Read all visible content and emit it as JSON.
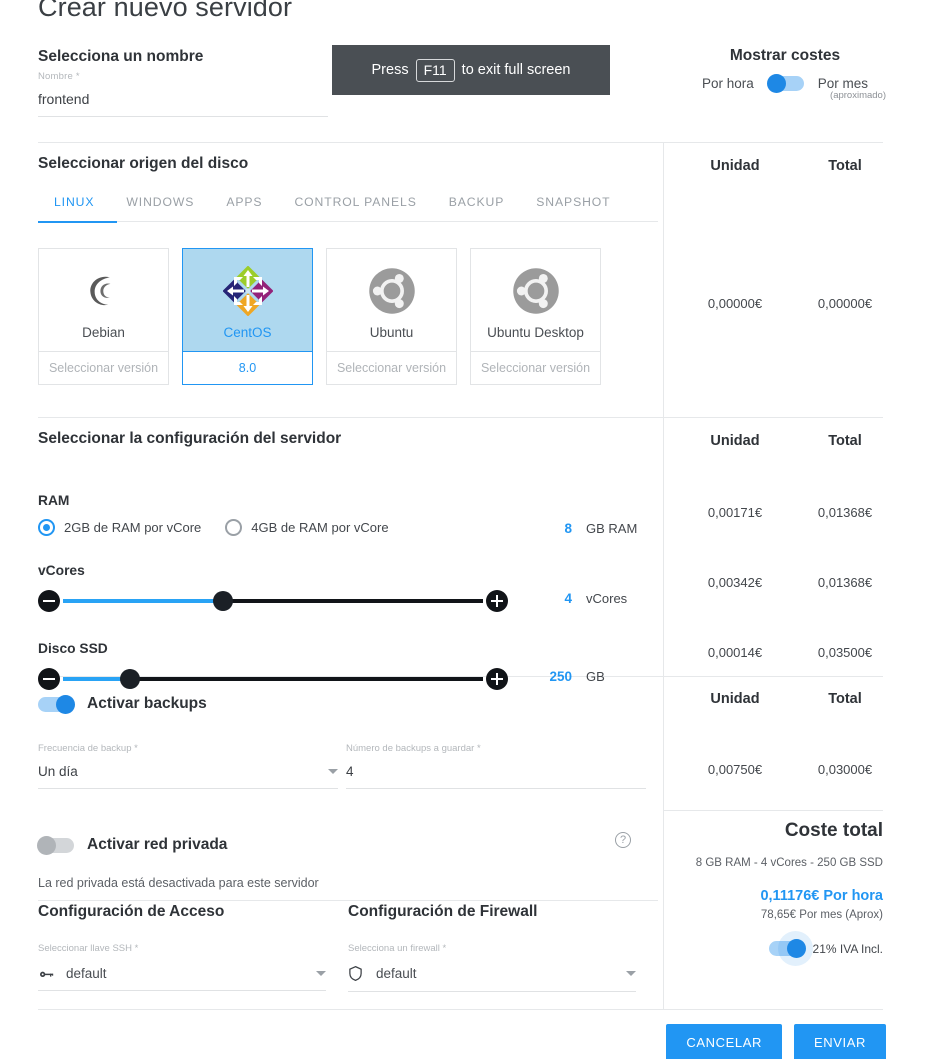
{
  "page_title": "Crear nuevo servidor",
  "fullscreen_banner": {
    "prefix": "Press",
    "key": "F11",
    "suffix": "to exit full screen"
  },
  "name_section": {
    "heading": "Selecciona un nombre",
    "field_label": "Nombre *",
    "value": "frontend",
    "placeholder": "Nombre"
  },
  "costs_toggle": {
    "title": "Mostrar costes",
    "left_label": "Por hora",
    "right_label": "Por mes",
    "approx": "(aproximado)",
    "state": "left"
  },
  "disk_section": {
    "heading": "Seleccionar origen del disco",
    "tabs": [
      {
        "label": "LINUX",
        "active": true
      },
      {
        "label": "WINDOWS",
        "active": false
      },
      {
        "label": "APPS",
        "active": false
      },
      {
        "label": "CONTROL PANELS",
        "active": false
      },
      {
        "label": "BACKUP",
        "active": false
      },
      {
        "label": "SNAPSHOT",
        "active": false
      }
    ],
    "os_cards": [
      {
        "name": "Debian",
        "version": "Seleccionar versión",
        "selected": false,
        "icon": "debian-swirl-icon"
      },
      {
        "name": "CentOS",
        "version": "8.0",
        "selected": true,
        "icon": "centos-logo-icon"
      },
      {
        "name": "Ubuntu",
        "version": "Seleccionar versión",
        "selected": false,
        "icon": "ubuntu-circle-icon"
      },
      {
        "name": "Ubuntu Desktop",
        "version": "Seleccionar versión",
        "selected": false,
        "icon": "ubuntu-circle-icon"
      }
    ],
    "price_headers": {
      "unit": "Unidad",
      "total": "Total"
    },
    "price_unit": "0,00000€",
    "price_total": "0,00000€"
  },
  "config_section": {
    "heading": "Seleccionar la configuración del servidor",
    "price_headers": {
      "unit": "Unidad",
      "total": "Total"
    },
    "ram": {
      "label": "RAM",
      "option1": "2GB de RAM por vCore",
      "option2": "4GB de RAM por vCore",
      "selected": 1,
      "value": "8",
      "unit": "GB RAM",
      "price_unit": "0,00171€",
      "price_total": "0,01368€"
    },
    "vcores": {
      "label": "vCores",
      "value": "4",
      "unit": "vCores",
      "fill_percent": 38,
      "price_unit": "0,00342€",
      "price_total": "0,01368€"
    },
    "ssd": {
      "label": "Disco SSD",
      "value": "250",
      "unit": "GB",
      "fill_percent": 16,
      "price_unit": "0,00014€",
      "price_total": "0,03500€"
    }
  },
  "backup_section": {
    "toggle_label": "Activar backups",
    "toggle_state": "on",
    "frequency_label": "Frecuencia de backup *",
    "frequency_value": "Un día",
    "count_label": "Número de backups a guardar *",
    "count_value": "4",
    "price_headers": {
      "unit": "Unidad",
      "total": "Total"
    },
    "price_unit": "0,00750€",
    "price_total": "0,03000€"
  },
  "network_section": {
    "toggle_label": "Activar red privada",
    "toggle_state": "off",
    "help_icon": "?",
    "note": "La red privada está desactivada para este servidor"
  },
  "access_section": {
    "heading": "Configuración de Acceso",
    "field_label": "Seleccionar llave SSH *",
    "value": "default",
    "icon": "key-icon"
  },
  "firewall_section": {
    "heading": "Configuración de Firewall",
    "field_label": "Selecciona un firewall *",
    "value": "default",
    "icon": "shield-icon"
  },
  "total_section": {
    "heading": "Coste total",
    "spec": "8 GB RAM - 4 vCores - 250 GB SSD",
    "per_hour": "0,11176€ Por hora",
    "per_month": "78,65€ Por mes (Aprox)",
    "iva_label": "21% IVA Incl.",
    "iva_state": "on"
  },
  "footer": {
    "cancel": "CANCELAR",
    "submit": "ENVIAR"
  },
  "colors": {
    "accent": "#2196f3",
    "selected_bg": "#aed8ef",
    "slider_fill": "#29a3f5",
    "banner_bg": "#4a4f54"
  }
}
